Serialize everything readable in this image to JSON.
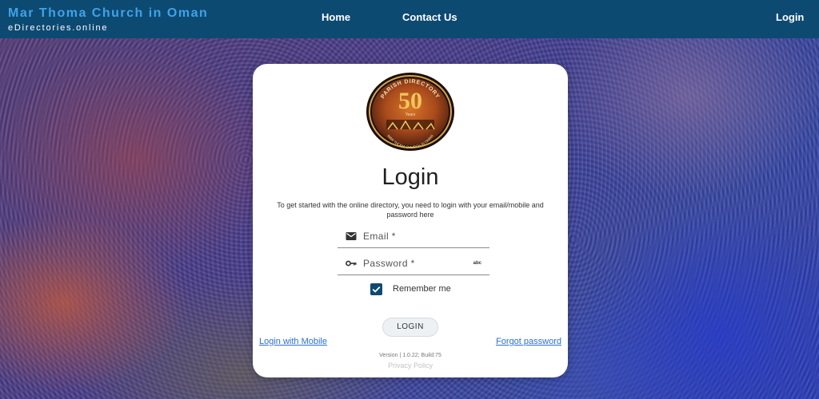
{
  "header": {
    "brand_title": "Mar Thoma Church in Oman",
    "brand_subtitle": "eDirectories.online",
    "nav": {
      "home": "Home",
      "contact": "Contact Us",
      "login": "Login"
    },
    "background_color": "#0d4a72",
    "brand_color": "#3fa3e8"
  },
  "login_card": {
    "logo": {
      "icon": "parish-directory-50-years-emblem",
      "arc_text": "PARISH DIRECTORY",
      "number": "50",
      "years_text": "Years",
      "bottom_text": "MAR THOMA CHURCH IN OMAN"
    },
    "title": "Login",
    "description": "To get started with the online directory, you need to login with your email/mobile and password here",
    "email": {
      "label": "Email *",
      "icon": "mail-icon"
    },
    "password": {
      "label": "Password *",
      "icon": "key-icon",
      "reveal_label": "abc"
    },
    "remember_me": {
      "label": "Remember me",
      "checked": true
    },
    "login_button": "LOGIN",
    "login_with_mobile": "Login with Mobile",
    "forgot_password": "Forgot password",
    "version": "Version | 1.0.22; Build:75",
    "privacy_policy": "Privacy Policy"
  }
}
